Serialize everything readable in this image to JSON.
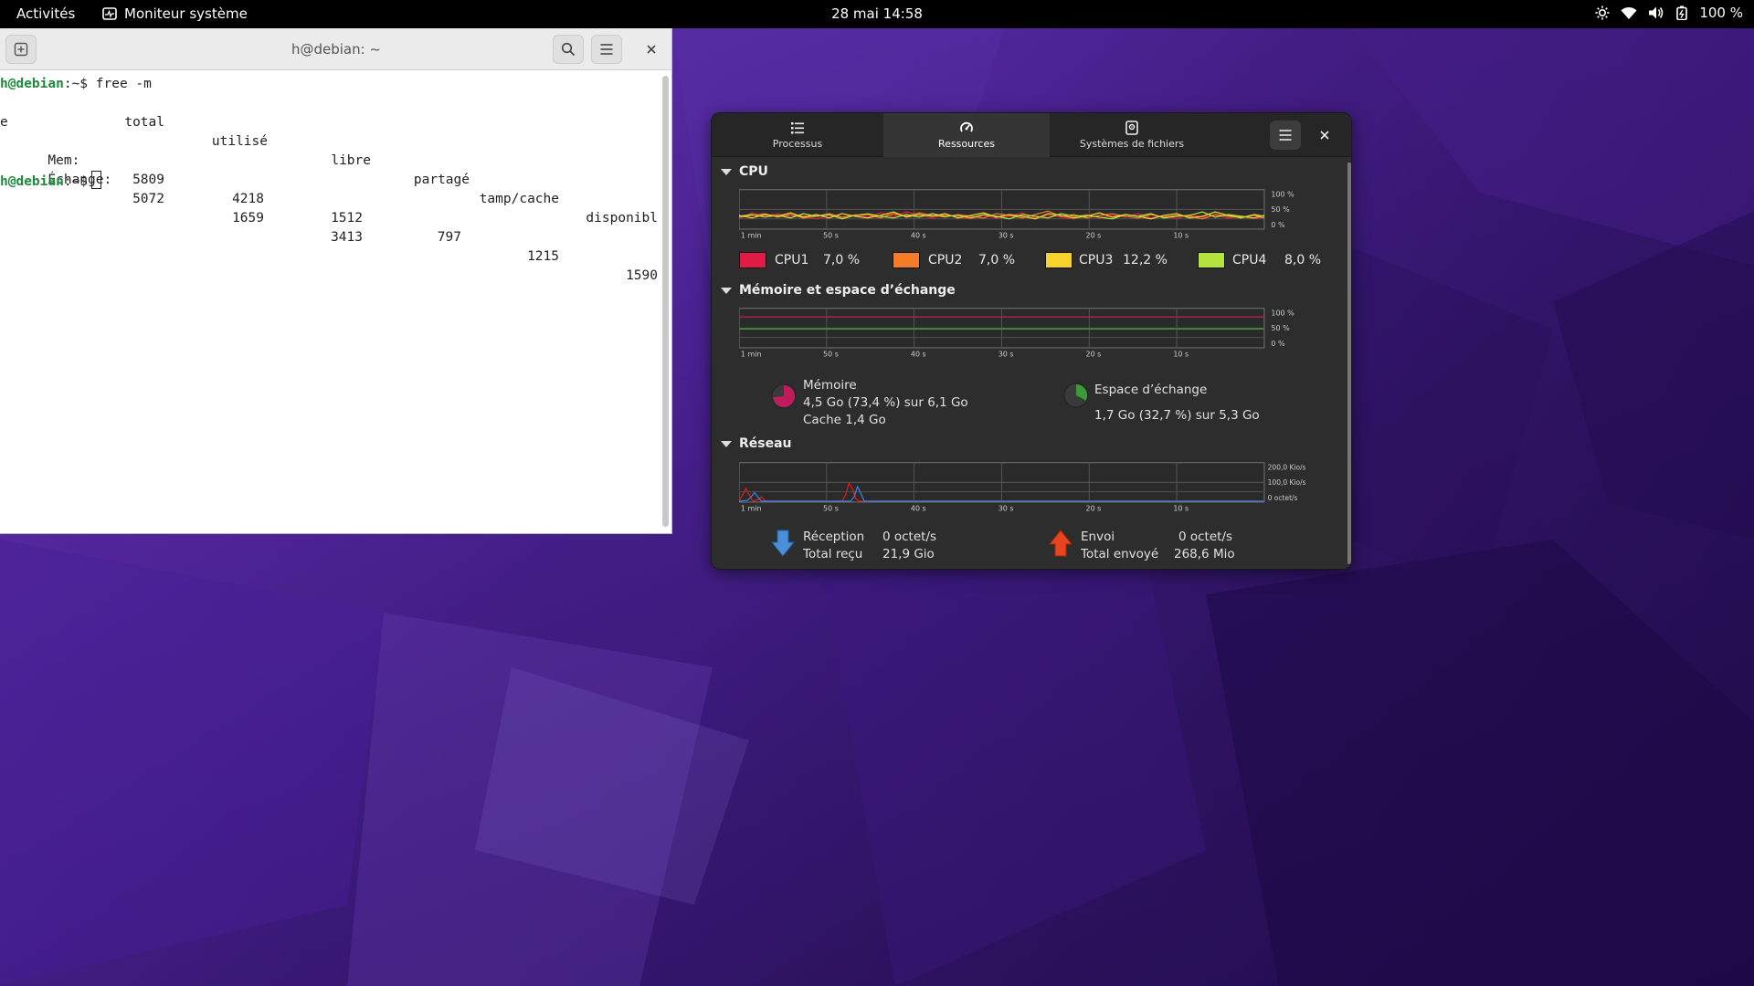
{
  "topbar": {
    "activities": "Activités",
    "app_name": "Moniteur système",
    "clock": "28 mai  14:58",
    "battery": "100 %"
  },
  "terminal": {
    "title": "h@debian: ~",
    "prompt_user": "h@debian",
    "prompt_rest": ":~$",
    "command": " free -m",
    "headers": [
      "total",
      "utilisé",
      "libre",
      "partagé",
      "tamp/cache",
      "disponibl"
    ],
    "header_wrap": "e",
    "rows": [
      {
        "label": "Mem:",
        "values": [
          "5809",
          "4218",
          "1512",
          "797",
          "1215",
          "1590"
        ]
      },
      {
        "label": "Échange:",
        "values": [
          "5072",
          "1659",
          "3413"
        ]
      }
    ]
  },
  "sysmon": {
    "tabs": [
      {
        "label": "Processus",
        "icon": "list-icon"
      },
      {
        "label": "Ressources",
        "icon": "gauge-icon"
      },
      {
        "label": "Systèmes de fichiers",
        "icon": "disk-icon"
      }
    ],
    "active_tab": "Ressources",
    "time_axis": [
      "1 min",
      "50 s",
      "40 s",
      "30 s",
      "20 s",
      "10 s"
    ],
    "cpu": {
      "heading": "CPU",
      "axis": [
        "100 %",
        "50 %",
        "0 %"
      ],
      "cores": [
        {
          "name": "CPU1",
          "value": "7,0 %",
          "color": "#e01b45"
        },
        {
          "name": "CPU2",
          "value": "7,0 %",
          "color": "#f57d27"
        },
        {
          "name": "CPU3",
          "value": "12,2 %",
          "color": "#f6d32d"
        },
        {
          "name": "CPU4",
          "value": "8,0 %",
          "color": "#b4e33b"
        }
      ]
    },
    "memory": {
      "heading": "Mémoire et espace d’échange",
      "axis": [
        "100 %",
        "50 %",
        "0 %"
      ],
      "mem_title": "Mémoire",
      "mem_usage": "4,5 Go (73,4 %) sur 6,1 Go",
      "mem_cache": "Cache 1,4 Go",
      "mem_fraction": 0.734,
      "mem_color": "#c01c5c",
      "swap_title": "Espace d’échange",
      "swap_usage": "1,7 Go (32,7 %) sur 5,3 Go",
      "swap_fraction": 0.327,
      "swap_color": "#3a9a3a"
    },
    "network": {
      "heading": "Réseau",
      "axis": [
        "200,0 Kio/s",
        "100,0 Kio/s",
        "0 octet/s"
      ],
      "rx_label": "Réception",
      "rx_rate": "0 octet/s",
      "rx_total_label": "Total reçu",
      "rx_total": "21,9 Gio",
      "tx_label": "Envoi",
      "tx_rate": "0 octet/s",
      "tx_total_label": "Total envoyé",
      "tx_total": "268,6 Mio"
    }
  }
}
